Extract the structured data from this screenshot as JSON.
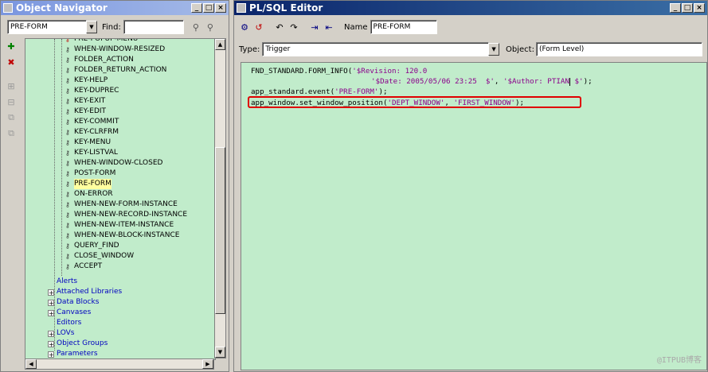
{
  "navigator": {
    "title": "Object Navigator",
    "module_value": "PRE-FORM",
    "find_label": "Find:",
    "find_value": "",
    "triggers": [
      "PRE-POPUP-MENU",
      "WHEN-WINDOW-RESIZED",
      "FOLDER_ACTION",
      "FOLDER_RETURN_ACTION",
      "KEY-HELP",
      "KEY-DUPREC",
      "KEY-EXIT",
      "KEY-EDIT",
      "KEY-COMMIT",
      "KEY-CLRFRM",
      "KEY-MENU",
      "KEY-LISTVAL",
      "WHEN-WINDOW-CLOSED",
      "POST-FORM",
      "PRE-FORM",
      "ON-ERROR",
      "WHEN-NEW-FORM-INSTANCE",
      "WHEN-NEW-RECORD-INSTANCE",
      "WHEN-NEW-ITEM-INSTANCE",
      "WHEN-NEW-BLOCK-INSTANCE",
      "QUERY_FIND",
      "CLOSE_WINDOW",
      "ACCEPT"
    ],
    "selected_trigger": "PRE-FORM",
    "nodes": [
      {
        "label": "Alerts",
        "expandable": false
      },
      {
        "label": "Attached Libraries",
        "expandable": true
      },
      {
        "label": "Data Blocks",
        "expandable": true
      },
      {
        "label": "Canvases",
        "expandable": true
      },
      {
        "label": "Editors",
        "expandable": false
      },
      {
        "label": "LOVs",
        "expandable": true
      },
      {
        "label": "Object Groups",
        "expandable": true
      },
      {
        "label": "Parameters",
        "expandable": true
      }
    ]
  },
  "editor": {
    "title": "PL/SQL Editor",
    "name_label": "Name",
    "name_value": "PRE-FORM",
    "type_label": "Type:",
    "type_value": "Trigger",
    "object_label": "Object:",
    "object_value": "(Form Level)",
    "code": {
      "l1a": "FND_STANDARD.FORM_INFO(",
      "l1b": "'$Revision: 120.0",
      "l2": "'$Date: 2005/05/06 23:25  $'",
      "l2c": ", ",
      "l2d": "'$Author: PTIAN",
      "l2e": " $'",
      "l2f": ");",
      "l3a": "app_standard.event(",
      "l3b": "'PRE-FORM'",
      "l3c": ");",
      "l4a": "app_window.set_window_position(",
      "l4b": "'DEPT_WINDOW'",
      "l4c": ", ",
      "l4d": "'FIRST_WINDOW'",
      "l4e": ");"
    }
  },
  "watermark": "@ITPUB博客",
  "colors": {
    "tree_bg": "#c1eccb",
    "highlight_border": "#e00000",
    "string": "#8b008b"
  }
}
